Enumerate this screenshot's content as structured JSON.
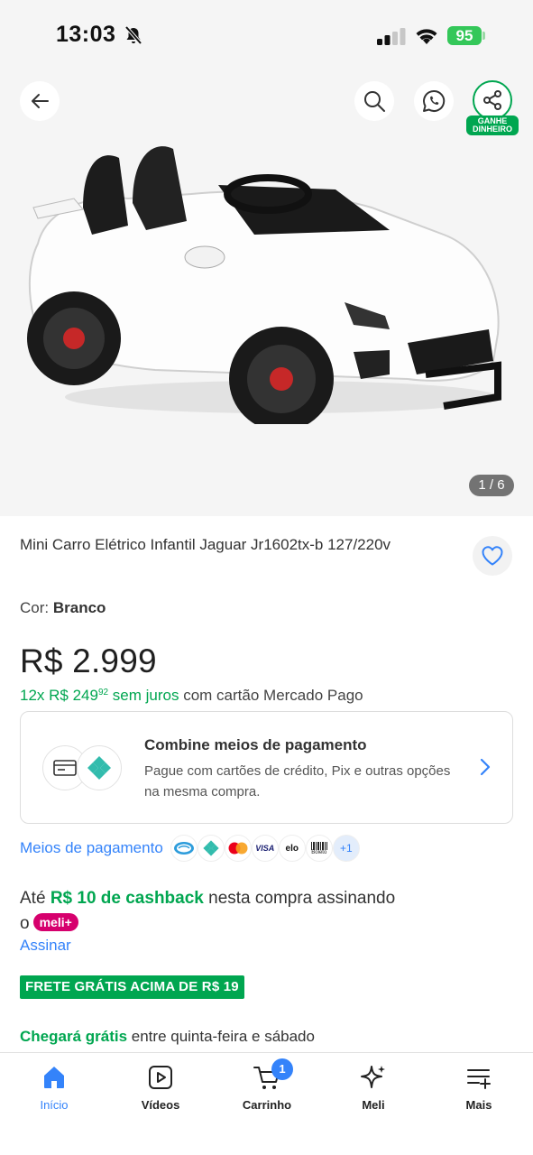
{
  "status_bar": {
    "time": "13:03",
    "battery": "95"
  },
  "gallery": {
    "counter": "1 / 6",
    "share_badge": "GANHE DINHEIRO"
  },
  "product": {
    "title": "Mini Carro Elétrico Infantil Jaguar Jr1602tx-b 127/220v",
    "color_label": "Cor: ",
    "color_value": "Branco",
    "price": "R$ 2.999",
    "installments_green": "12x R$ 249",
    "installments_cents": "92",
    "installments_green2": " sem juros",
    "installments_rest": " com cartão Mercado Pago"
  },
  "payment_card": {
    "title": "Combine meios de pagamento",
    "description": "Pague com cartões de crédito, Pix e outras opções na mesma compra."
  },
  "payment_methods": {
    "label": "Meios de pagamento",
    "icons": [
      "mercado-pago-icon",
      "pix-icon",
      "mastercard-icon",
      "visa-icon",
      "elo-icon",
      "boleto-icon"
    ],
    "visa": "VISA",
    "elo": "elo",
    "boleto": "Boleto",
    "more": "+1"
  },
  "cashback": {
    "prefix": "Até ",
    "amount": "R$ 10 de cashback",
    "middle": " nesta compra assinando o",
    "badge": "meli+",
    "link": "Assinar"
  },
  "shipping": {
    "badge": "FRETE GRÁTIS ACIMA DE R$ 19",
    "delivery_green": "Chegará grátis",
    "delivery_rest": " entre quinta-feira e sábado"
  },
  "tabs": [
    {
      "label": "Início",
      "active": true
    },
    {
      "label": "Vídeos"
    },
    {
      "label": "Carrinho",
      "badge": "1"
    },
    {
      "label": "Meli"
    },
    {
      "label": "Mais"
    }
  ],
  "colors": {
    "brand_blue": "#3483fa",
    "green": "#00a650",
    "meli_pink": "#d6006d"
  }
}
